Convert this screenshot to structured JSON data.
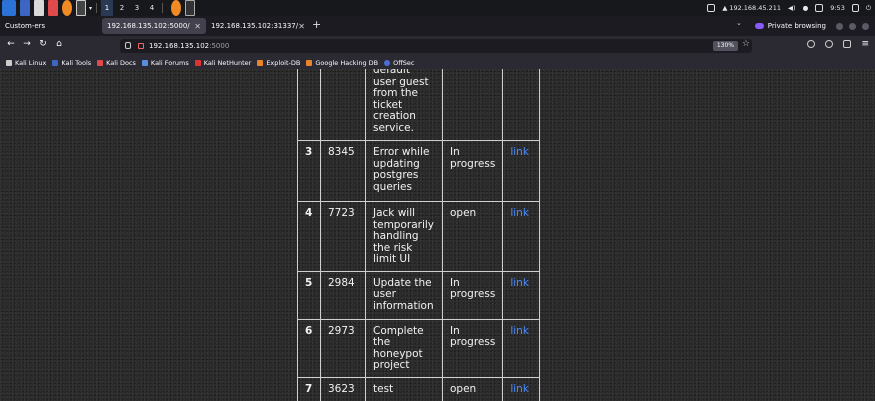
{
  "panel": {
    "workspaces": [
      "1",
      "2",
      "3",
      "4"
    ],
    "ip": "192.168.45.211",
    "clock": "9:53"
  },
  "tabs": [
    {
      "label": "Custom-ers"
    },
    {
      "label": "192.168.135.102:5000/",
      "active": true
    },
    {
      "label": "192.168.135.102:31337/"
    }
  ],
  "private_label": "Private browsing",
  "url": {
    "host": "192.168.135.102",
    "port": ":5000"
  },
  "zoom": "130%",
  "bookmarks": [
    "Kali Linux",
    "Kali Tools",
    "Kali Docs",
    "Kali Forums",
    "Kali NetHunter",
    "Exploit-DB",
    "Google Hacking DB",
    "OffSec"
  ],
  "table": {
    "rows": [
      {
        "no": "",
        "id": "",
        "desc": "default user guest from the ticket creation service.",
        "status": "",
        "link": ""
      },
      {
        "no": "3",
        "id": "8345",
        "desc": "Error while updating postgres queries",
        "status": "In progress",
        "link": "link"
      },
      {
        "no": "4",
        "id": "7723",
        "desc": "Jack will temporarily handling the risk limit UI",
        "status": "open",
        "link": "link"
      },
      {
        "no": "5",
        "id": "2984",
        "desc": "Update the user information",
        "status": "In progress",
        "link": "link"
      },
      {
        "no": "6",
        "id": "2973",
        "desc": "Complete the honeypot project",
        "status": "In progress",
        "link": "link"
      },
      {
        "no": "7",
        "id": "3623",
        "desc": "test",
        "status": "open",
        "link": "link"
      }
    ]
  },
  "colors": {
    "link": "#4a8cff",
    "panel": "#17181c",
    "toolbar": "#2b2a33"
  }
}
